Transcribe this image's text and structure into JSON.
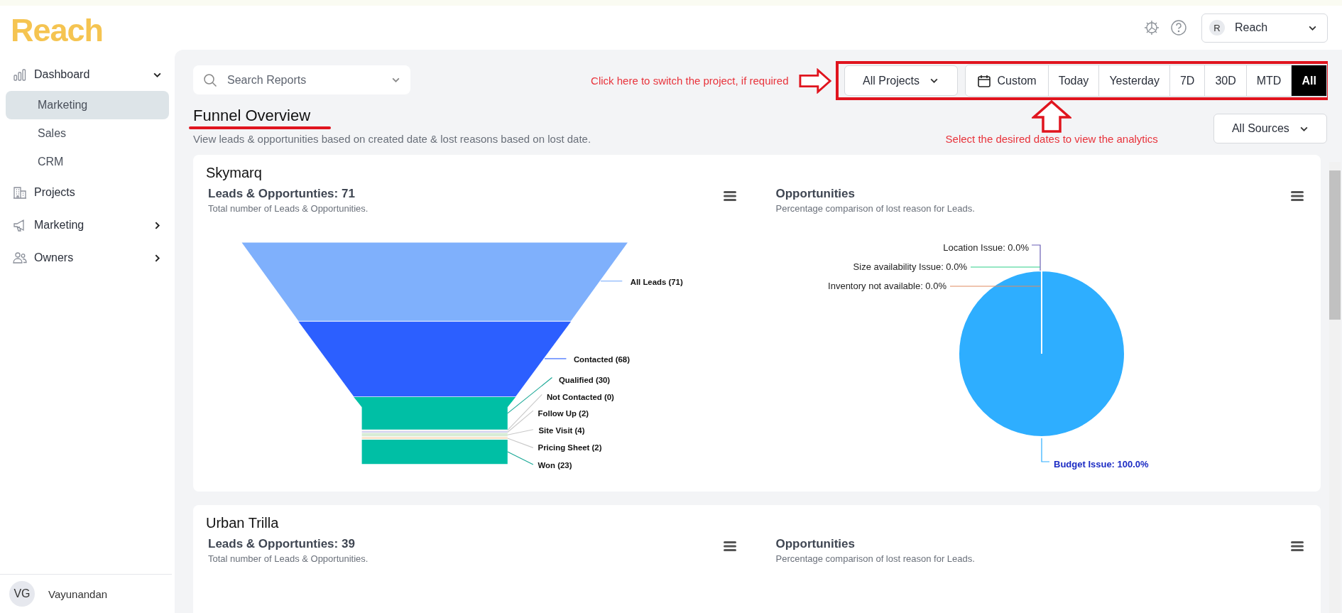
{
  "app": {
    "logo": "Reach"
  },
  "sidebar": {
    "items": [
      {
        "label": "Dashboard",
        "kind": "group",
        "expanded": true,
        "children": [
          {
            "label": "Marketing",
            "selected": true
          },
          {
            "label": "Sales",
            "selected": false
          },
          {
            "label": "CRM",
            "selected": false
          }
        ]
      },
      {
        "label": "Projects",
        "kind": "link"
      },
      {
        "label": "Marketing",
        "kind": "group",
        "expanded": false
      },
      {
        "label": "Owners",
        "kind": "group",
        "expanded": false
      }
    ],
    "user": {
      "initials": "VG",
      "name": "Vayunandan"
    }
  },
  "header": {
    "account": {
      "initial": "R",
      "name": "Reach"
    }
  },
  "toolbar": {
    "search": {
      "placeholder": "Search Reports"
    },
    "project_filter": "All Projects",
    "date_ranges": [
      {
        "label": "Custom",
        "selected": false
      },
      {
        "label": "Today",
        "selected": false
      },
      {
        "label": "Yesterday",
        "selected": false
      },
      {
        "label": "7D",
        "selected": false
      },
      {
        "label": "30D",
        "selected": false
      },
      {
        "label": "MTD",
        "selected": false
      },
      {
        "label": "All",
        "selected": true
      }
    ],
    "source_filter": "All Sources"
  },
  "annotations": {
    "project_hint": "Click here to switch the project, if required",
    "date_hint": "Select the desired dates to view the analytics"
  },
  "page": {
    "title": "Funnel Overview",
    "subtitle": "View leads & opportunities based on created date & lost reasons based on lost date."
  },
  "projects": [
    {
      "name": "Skymarq",
      "funnel": {
        "title": "Leads & Opportunties: 71",
        "subtitle": "Total number of Leads & Opportunities.",
        "stages": [
          {
            "label": "All Leads (71)",
            "color": "#7fb0fc"
          },
          {
            "label": "Contacted (68)",
            "color": "#2c5fff"
          },
          {
            "label": "Qualified (30)",
            "color": "#00bfa5"
          },
          {
            "label": "Not Contacted (0)",
            "color": "#e8e8e8"
          },
          {
            "label": "Follow Up (2)",
            "color": "#d4d2f2"
          },
          {
            "label": "Site Visit (4)",
            "color": "#d8ecd6"
          },
          {
            "label": "Pricing Sheet (2)",
            "color": "#fbe2c8"
          },
          {
            "label": "Won (23)",
            "color": "#00bfa5"
          }
        ]
      },
      "lost_reasons": {
        "title": "Opportunities",
        "subtitle": "Percentage comparison of lost reason for Leads.",
        "chart_data": {
          "type": "pie",
          "values": [
            0,
            0,
            0,
            100
          ],
          "value_labels": [
            "Location Issue: 0.0%",
            "Size availability Issue: 0.0%",
            "Inventory not available: 0.0%",
            "Budget Issue: 100.0%"
          ]
        }
      }
    },
    {
      "name": "Urban Trilla",
      "funnel": {
        "title": "Leads & Opportunties: 39",
        "subtitle": "Total number of Leads & Opportunities."
      },
      "lost_reasons": {
        "title": "Opportunities",
        "subtitle": "Percentage comparison of lost reason for Leads."
      }
    }
  ]
}
